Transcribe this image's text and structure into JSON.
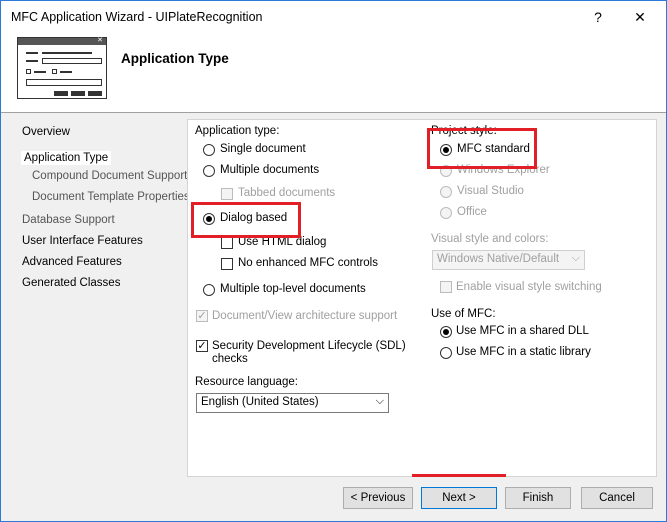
{
  "window": {
    "title": "MFC Application Wizard - UIPlateRecognition",
    "help_glyph": "?",
    "close_glyph": "✕"
  },
  "header": {
    "title": "Application Type",
    "icon": "wizard-window-icon"
  },
  "nav": {
    "items": [
      {
        "label": "Overview"
      },
      {
        "label": "Application Type"
      },
      {
        "label": "Compound Document Support"
      },
      {
        "label": "Document Template Properties"
      },
      {
        "label": "Database Support"
      },
      {
        "label": "User Interface Features"
      },
      {
        "label": "Advanced Features"
      },
      {
        "label": "Generated Classes"
      }
    ]
  },
  "app_type": {
    "label": "Application type:",
    "single_document": "Single document",
    "multiple_documents": "Multiple documents",
    "tabbed_documents": "Tabbed documents",
    "dialog_based": "Dialog based",
    "use_html_dialog": "Use HTML dialog",
    "no_enhanced_mfc_controls": "No enhanced MFC controls",
    "multiple_top_level": "Multiple top-level documents",
    "selected": "Dialog based"
  },
  "doc_view": "Document/View architecture support",
  "sdl": {
    "line1": "Security Development Lifecycle (SDL)",
    "line2": "checks",
    "checked": true
  },
  "resource_language": {
    "label": "Resource language:",
    "value": "English (United States)"
  },
  "project_style": {
    "label": "Project style:",
    "mfc_standard": "MFC standard",
    "windows_explorer": "Windows Explorer",
    "visual_studio": "Visual Studio",
    "office": "Office",
    "selected": "MFC standard"
  },
  "visual_style": {
    "label": "Visual style and colors:",
    "value": "Windows Native/Default",
    "enable_switching": "Enable visual style switching"
  },
  "use_of_mfc": {
    "label": "Use of MFC:",
    "shared_dll": "Use MFC in a shared DLL",
    "static_library": "Use MFC in a static library",
    "selected": "Use MFC in a shared DLL"
  },
  "buttons": {
    "previous": "< Previous",
    "next": "Next >",
    "finish": "Finish",
    "cancel": "Cancel"
  },
  "colors": {
    "highlight": "#e21f26",
    "accent": "#0078d7"
  }
}
